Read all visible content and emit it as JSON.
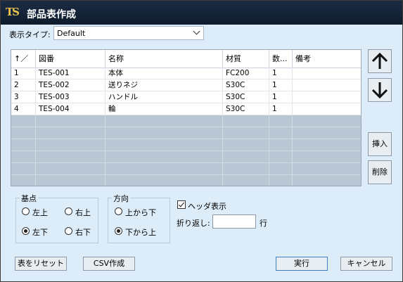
{
  "window": {
    "title": "部品表作成",
    "logo": "TS"
  },
  "display_type": {
    "label": "表示タイプ:",
    "value": "Default"
  },
  "table": {
    "columns": [
      "↑／",
      "図番",
      "名称",
      "材質",
      "数...",
      "備考"
    ],
    "rows": [
      [
        "1",
        "TES-001",
        "本体",
        "FC200",
        "1",
        ""
      ],
      [
        "2",
        "TES-002",
        "送りネジ",
        "S30C",
        "1",
        ""
      ],
      [
        "3",
        "TES-003",
        "ハンドル",
        "S30C",
        "1",
        ""
      ],
      [
        "4",
        "TES-004",
        "輪",
        "S30C",
        "1",
        ""
      ]
    ]
  },
  "side_buttons": {
    "up": "up-arrow-icon",
    "down": "down-arrow-icon",
    "insert": "挿入",
    "delete": "削除"
  },
  "base_point": {
    "label": "基点",
    "top_left": "左上",
    "top_right": "右上",
    "bottom_left": "左下",
    "bottom_right": "右下",
    "selected": "左下"
  },
  "direction": {
    "label": "方向",
    "top_down": "上から下",
    "bottom_up": "下から上",
    "selected": "下から上"
  },
  "header_display": {
    "label": "ヘッダ表示",
    "checked": true
  },
  "wrap": {
    "label": "折り返し:",
    "value": "",
    "unit": "行"
  },
  "buttons": {
    "reset": "表をリセット",
    "csv": "CSV作成",
    "run": "実行",
    "cancel": "キャンセル"
  },
  "colors": {
    "titlebar": "#0e1b2c",
    "background": "#dcecf8",
    "empty_rows": "#b9c7d4"
  }
}
